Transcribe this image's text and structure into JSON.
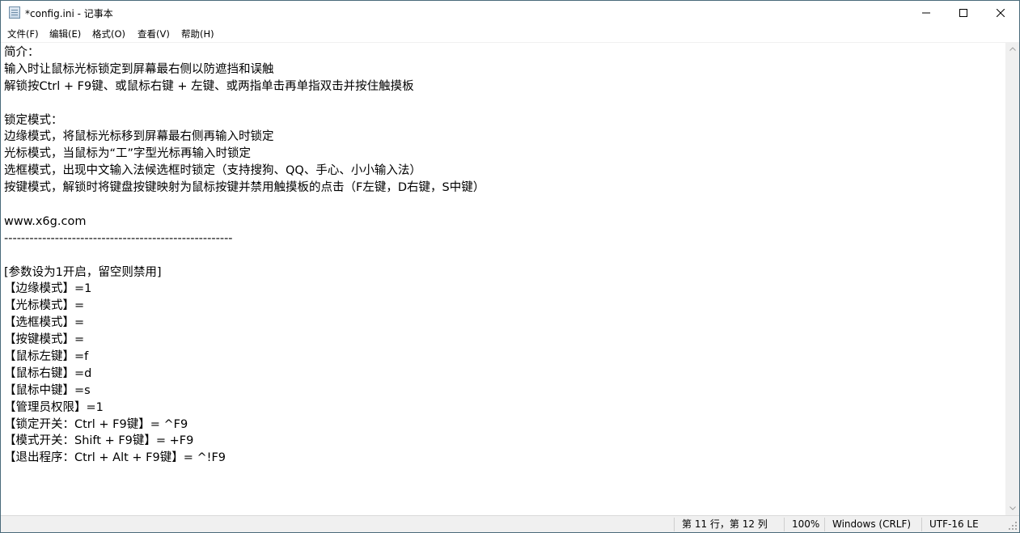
{
  "window": {
    "title": "*config.ini - 记事本"
  },
  "menu": {
    "items": [
      "文件(F)",
      "编辑(E)",
      "格式(O)",
      "查看(V)",
      "帮助(H)"
    ]
  },
  "editor": {
    "lines": [
      "简介：",
      "输入时让鼠标光标锁定到屏幕最右侧以防遮挡和误触",
      "解锁按Ctrl + F9键、或鼠标右键 + 左键、或两指单击再单指双击并按住触摸板",
      "",
      "锁定模式：",
      "边缘模式，将鼠标光标移到屏幕最右侧再输入时锁定",
      "光标模式，当鼠标为“工”字型光标再输入时锁定",
      "选框模式，出现中文输入法候选框时锁定（支持搜狗、QQ、手心、小小输入法）",
      "按键模式，解锁时将键盘按键映射为鼠标按键并禁用触摸板的点击（F左键，D右键，S中键）",
      "",
      "www.x6g.com",
      "------------------------------------------------------",
      "",
      "[参数设为1开启，留空则禁用]",
      "【边缘模式】=1",
      "【光标模式】=",
      "【选框模式】=",
      "【按键模式】=",
      "【鼠标左键】=f",
      "【鼠标右键】=d",
      "【鼠标中键】=s",
      "【管理员权限】=1",
      "【锁定开关：Ctrl + F9键】= ^F9",
      "【模式开关：Shift + F9键】= +F9",
      "【退出程序：Ctrl + Alt + F9键】= ^!F9"
    ]
  },
  "statusbar": {
    "position": "第 11 行，第 12 列",
    "zoom": "100%",
    "line_ending": "Windows (CRLF)",
    "encoding": "UTF-16 LE"
  },
  "icons": {
    "app": "notepad-icon",
    "minimize": "minimize-icon",
    "maximize": "maximize-icon",
    "close": "close-icon",
    "scroll_up": "chevron-up-icon",
    "scroll_down": "chevron-down-icon",
    "grip": "resize-grip-icon"
  }
}
